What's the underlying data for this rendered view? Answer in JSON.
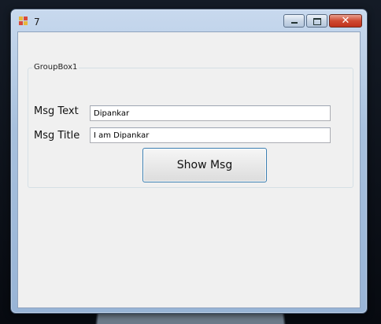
{
  "window": {
    "title": "7",
    "icon": "app-icon",
    "controls": {
      "minimize_icon": "minimize-icon",
      "maximize_icon": "maximize-icon",
      "close_label": "✕"
    }
  },
  "form": {
    "groupbox_label": "GroupBox1",
    "msg_text_label": "Msg Text",
    "msg_text_value": "Dipankar",
    "msg_title_label": "Msg Title",
    "msg_title_value": "I am Dipankar",
    "show_button_label": "Show Msg"
  },
  "colors": {
    "client_bg": "#f0f0f0",
    "close_red": "#cf4a32",
    "focus_border": "#3c7fb1"
  }
}
